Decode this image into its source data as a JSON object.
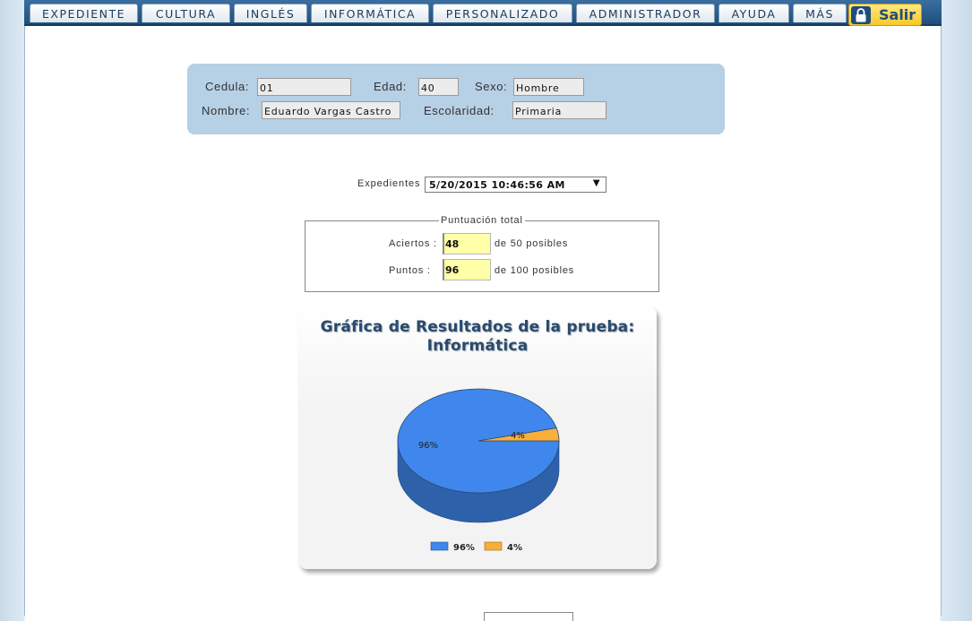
{
  "nav": {
    "tabs": [
      {
        "label": "EXPEDIENTE"
      },
      {
        "label": "CULTURA"
      },
      {
        "label": "INGLÉS"
      },
      {
        "label": "INFORMÁTICA"
      },
      {
        "label": "PERSONALIZADO"
      },
      {
        "label": "ADMINISTRADOR"
      },
      {
        "label": "AYUDA"
      },
      {
        "label": "MÁS"
      }
    ],
    "logout_label": "Salir"
  },
  "profile": {
    "cedula_label": "Cedula:",
    "cedula_value": "01",
    "edad_label": "Edad:",
    "edad_value": "40",
    "sexo_label": "Sexo:",
    "sexo_value": "Hombre",
    "nombre_label": "Nombre:",
    "nombre_value": "Eduardo Vargas Castro",
    "escolaridad_label": "Escolaridad:",
    "escolaridad_value": "Primaria"
  },
  "expedientes": {
    "label": "Expedientes",
    "selected": "5/20/2015 10:46:56 AM"
  },
  "score": {
    "legend": "Puntuación total",
    "aciertos_label": "Aciertos :",
    "aciertos_value": "48",
    "aciertos_suffix": "de 50 posibles",
    "puntos_label": "Puntos :",
    "puntos_value": "96",
    "puntos_suffix": "de 100 posibles"
  },
  "chart_data": {
    "type": "pie",
    "title_line1": "Gráfica de Resultados de la prueba:",
    "title_line2": "Informática",
    "slices": [
      {
        "label": "96%",
        "value": 96,
        "color": "#3f87ec"
      },
      {
        "label": "4%",
        "value": 4,
        "color": "#f9af3a"
      }
    ],
    "legend": [
      "96%",
      "4%"
    ]
  },
  "colors": {
    "nav": "#2a5f92",
    "accent": "#f7c927",
    "panel": "#b6d0e6",
    "highlight_field": "#ffffa8"
  }
}
